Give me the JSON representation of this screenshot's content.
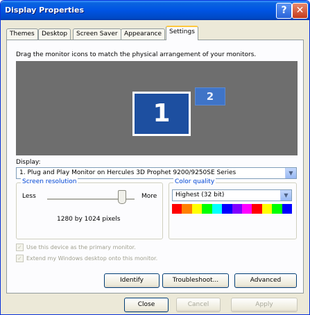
{
  "window": {
    "title": "Display Properties",
    "help_glyph": "?",
    "close_glyph": "✕"
  },
  "tabs": [
    {
      "label": "Themes"
    },
    {
      "label": "Desktop"
    },
    {
      "label": "Screen Saver"
    },
    {
      "label": "Appearance"
    },
    {
      "label": "Settings",
      "active": true
    }
  ],
  "settings": {
    "instruction": "Drag the monitor icons to match the physical arrangement of your monitors.",
    "monitors": [
      {
        "number": "1",
        "selected": true
      },
      {
        "number": "2",
        "selected": false
      }
    ],
    "display_label": "Display:",
    "display_value": "1. Plug and Play Monitor on Hercules 3D Prophet 9200/9250SE Series",
    "screen_resolution": {
      "label": "Screen resolution",
      "less_label": "Less",
      "more_label": "More",
      "value_text": "1280 by 1024 pixels",
      "slider_fraction": 0.85
    },
    "color_quality": {
      "label": "Color quality",
      "value": "Highest (32 bit)"
    },
    "checkboxes": [
      {
        "label": "Use this device as the primary monitor.",
        "checked": true,
        "enabled": false
      },
      {
        "label": "Extend my Windows desktop onto this monitor.",
        "checked": true,
        "enabled": false
      }
    ],
    "buttons": {
      "identify": "Identify",
      "troubleshoot": "Troubleshoot...",
      "advanced": "Advanced"
    }
  },
  "dialog_buttons": {
    "close": "Close",
    "cancel": "Cancel",
    "apply": "Apply"
  },
  "colors": {
    "titlebar": "#0054e3",
    "accent_tab": "#ffc83c",
    "monitor_bg": "#6e6e6e",
    "monitor_selected": "#1d4fa0",
    "group_label": "#0046d5",
    "spectrum": [
      "#ff0000",
      "#ff8000",
      "#ffff00",
      "#00ff00",
      "#00ffff",
      "#0000ff",
      "#8000ff",
      "#ff00ff",
      "#ff0000",
      "#ffff00",
      "#00ff00",
      "#0000ff"
    ]
  },
  "icons": {
    "dropdown": "chevron-down-icon",
    "help": "help-icon",
    "close": "close-icon"
  }
}
